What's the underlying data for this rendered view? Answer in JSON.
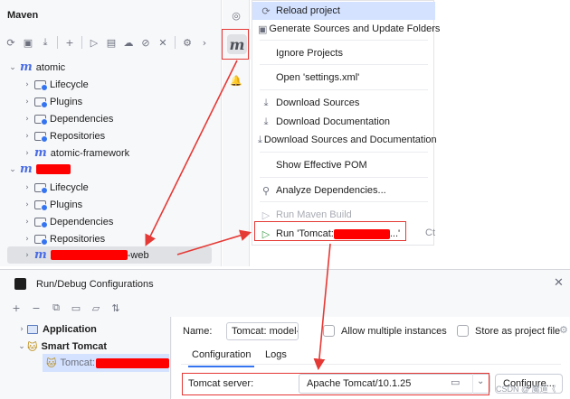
{
  "maven_panel": {
    "title": "Maven",
    "toolbar_icons": [
      "refresh-icon",
      "generate-sources-icon",
      "download-icon",
      "add-icon",
      "run-icon",
      "execute-goal-icon",
      "offline-icon",
      "skip-tests-icon",
      "collapse-icon",
      "settings-icon",
      "chevron-right-icon"
    ],
    "tree": [
      {
        "label": "atomic"
      },
      {
        "label": "Lifecycle"
      },
      {
        "label": "Plugins"
      },
      {
        "label": "Dependencies"
      },
      {
        "label": "Repositories"
      },
      {
        "label": "atomic-framework"
      },
      {
        "label": ""
      },
      {
        "label": "Lifecycle"
      },
      {
        "label": "Plugins"
      },
      {
        "label": "Dependencies"
      },
      {
        "label": "Repositories"
      },
      {
        "label": "-web"
      }
    ]
  },
  "side_stripe": {
    "icons": [
      "ai-assistant-icon",
      "maven-icon",
      "notifications-icon"
    ]
  },
  "context_menu": {
    "items": [
      {
        "label": "Reload project",
        "icon": "reload-icon"
      },
      {
        "label": "Generate Sources and Update Folders",
        "icon": "generate-sources-icon"
      },
      {
        "label": "Ignore Projects",
        "icon": ""
      },
      {
        "label": "Open 'settings.xml'",
        "icon": ""
      },
      {
        "label": "Download Sources",
        "icon": "download-icon"
      },
      {
        "label": "Download Documentation",
        "icon": "download-icon"
      },
      {
        "label": "Download Sources and Documentation",
        "icon": "download-icon"
      },
      {
        "label": "Show Effective POM",
        "icon": ""
      },
      {
        "label": "Analyze Dependencies...",
        "icon": "analyze-icon"
      },
      {
        "label": "Run Maven Build",
        "icon": "run-icon"
      },
      {
        "label_prefix": "Run 'Tomcat: ",
        "label_suffix": "...'",
        "icon": "run-icon"
      }
    ],
    "shortcut": "Ct"
  },
  "dialog": {
    "title": "Run/Debug Configurations",
    "tree": [
      {
        "label": "Application"
      },
      {
        "label": "Smart Tomcat"
      },
      {
        "label": "Tomcat:"
      }
    ],
    "name_label": "Name:",
    "name_value": "Tomcat: model-",
    "allow_multiple": "Allow multiple instances",
    "store_as_file": "Store as project file",
    "tabs": [
      "Configuration",
      "Logs"
    ],
    "tomcat_server_label": "Tomcat server:",
    "tomcat_server_value": "Apache Tomcat/10.1.25",
    "configure_button": "Configure..."
  },
  "watermark": "CSDN @ 魔道《"
}
